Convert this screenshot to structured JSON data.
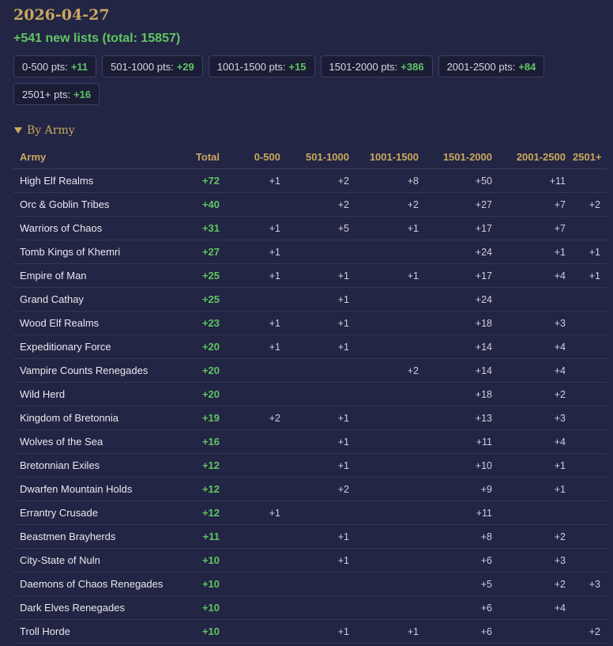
{
  "date": "2026-04-27",
  "summary": "+541 new lists (total: 15857)",
  "colors": {
    "accent": "#c9a85f",
    "positive": "#5fc563",
    "background": "#232544"
  },
  "buckets": [
    {
      "label": "0-500 pts:",
      "value": "+11"
    },
    {
      "label": "501-1000 pts:",
      "value": "+29"
    },
    {
      "label": "1001-1500 pts:",
      "value": "+15"
    },
    {
      "label": "1501-2000 pts:",
      "value": "+386"
    },
    {
      "label": "2001-2500 pts:",
      "value": "+84"
    },
    {
      "label": "2501+ pts:",
      "value": "+16"
    }
  ],
  "section": {
    "title": "By Army",
    "icon": "triangle-down-icon"
  },
  "table": {
    "headers": [
      "Army",
      "Total",
      "0-500",
      "501-1000",
      "1001-1500",
      "1501-2000",
      "2001-2500",
      "2501+"
    ],
    "rows": [
      [
        "High Elf Realms",
        "+72",
        "+1",
        "+2",
        "+8",
        "+50",
        "+11",
        ""
      ],
      [
        "Orc & Goblin Tribes",
        "+40",
        "",
        "+2",
        "+2",
        "+27",
        "+7",
        "+2"
      ],
      [
        "Warriors of Chaos",
        "+31",
        "+1",
        "+5",
        "+1",
        "+17",
        "+7",
        ""
      ],
      [
        "Tomb Kings of Khemri",
        "+27",
        "+1",
        "",
        "",
        "+24",
        "+1",
        "+1"
      ],
      [
        "Empire of Man",
        "+25",
        "+1",
        "+1",
        "+1",
        "+17",
        "+4",
        "+1"
      ],
      [
        "Grand Cathay",
        "+25",
        "",
        "+1",
        "",
        "+24",
        "",
        ""
      ],
      [
        "Wood Elf Realms",
        "+23",
        "+1",
        "+1",
        "",
        "+18",
        "+3",
        ""
      ],
      [
        "Expeditionary Force",
        "+20",
        "+1",
        "+1",
        "",
        "+14",
        "+4",
        ""
      ],
      [
        "Vampire Counts Renegades",
        "+20",
        "",
        "",
        "+2",
        "+14",
        "+4",
        ""
      ],
      [
        "Wild Herd",
        "+20",
        "",
        "",
        "",
        "+18",
        "+2",
        ""
      ],
      [
        "Kingdom of Bretonnia",
        "+19",
        "+2",
        "+1",
        "",
        "+13",
        "+3",
        ""
      ],
      [
        "Wolves of the Sea",
        "+16",
        "",
        "+1",
        "",
        "+11",
        "+4",
        ""
      ],
      [
        "Bretonnian Exiles",
        "+12",
        "",
        "+1",
        "",
        "+10",
        "+1",
        ""
      ],
      [
        "Dwarfen Mountain Holds",
        "+12",
        "",
        "+2",
        "",
        "+9",
        "+1",
        ""
      ],
      [
        "Errantry Crusade",
        "+12",
        "+1",
        "",
        "",
        "+11",
        "",
        ""
      ],
      [
        "Beastmen Brayherds",
        "+11",
        "",
        "+1",
        "",
        "+8",
        "+2",
        ""
      ],
      [
        "City-State of Nuln",
        "+10",
        "",
        "+1",
        "",
        "+6",
        "+3",
        ""
      ],
      [
        "Daemons of Chaos Renegades",
        "+10",
        "",
        "",
        "",
        "+5",
        "+2",
        "+3"
      ],
      [
        "Dark Elves Renegades",
        "+10",
        "",
        "",
        "",
        "+6",
        "+4",
        ""
      ],
      [
        "Troll Horde",
        "+10",
        "",
        "+1",
        "+1",
        "+6",
        "",
        "+2"
      ]
    ]
  }
}
